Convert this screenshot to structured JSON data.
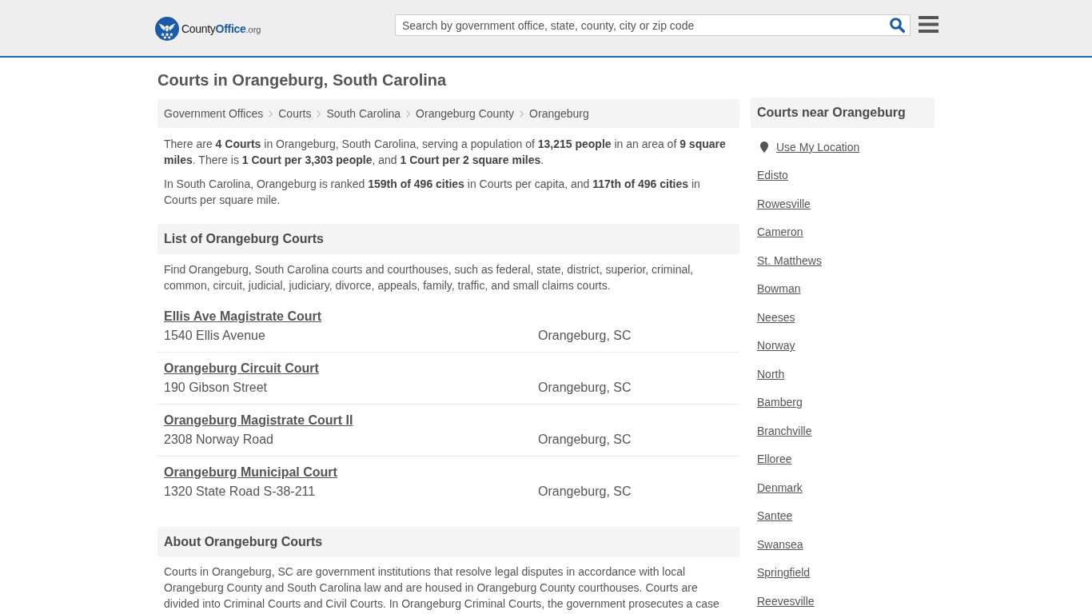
{
  "header": {
    "logo": {
      "name": "County",
      "highlight": "Office",
      "suffix": ".org"
    },
    "search": {
      "placeholder": "Search by government office, state, county, city or zip code"
    }
  },
  "page_title": "Courts in Orangeburg, South Carolina",
  "breadcrumb": [
    "Government Offices",
    "Courts",
    "South Carolina",
    "Orangeburg County",
    "Orangeburg"
  ],
  "intro": [
    "There are **4 Courts** in Orangeburg, South Carolina, serving a population of **13,215 people** in an area of **9 square miles**. There is **1 Court per 3,303 people**, and **1 Court per 2 square miles**.",
    "In South Carolina, Orangeburg is ranked **159th of 496 cities** in Courts per capita, and **117th of 496 cities** in Courts per square mile."
  ],
  "list_section": {
    "heading": "List of Orangeburg Courts",
    "description": "Find Orangeburg, South Carolina courts and courthouses, such as federal, state, district, superior, criminal, common, circuit, judicial, judiciary, divorce, appeals, family, traffic, and small claims courts.",
    "courts": [
      {
        "name": "Ellis Ave Magistrate Court",
        "address": "1540 Ellis Avenue",
        "city": "Orangeburg, SC"
      },
      {
        "name": "Orangeburg Circuit Court",
        "address": "190 Gibson Street",
        "city": "Orangeburg, SC"
      },
      {
        "name": "Orangeburg Magistrate Court II",
        "address": "2308 Norway Road",
        "city": "Orangeburg, SC"
      },
      {
        "name": "Orangeburg Municipal Court",
        "address": "1320 State Road S-38-211",
        "city": "Orangeburg, SC"
      }
    ]
  },
  "about_section": {
    "heading": "About Orangeburg Courts",
    "text": "Courts in Orangeburg, SC are government institutions that resolve legal disputes in accordance with local Orangeburg County and South Carolina law and are housed in Orangeburg County courthouses. Courts are divided into Criminal Courts and Civil Courts. In Orangeburg Criminal Courts, the government prosecutes a case"
  },
  "sidebar": {
    "heading": "Courts near Orangeburg",
    "location_link": "Use My Location",
    "links": [
      "Edisto",
      "Rowesville",
      "Cameron",
      "St. Matthews",
      "Bowman",
      "Neeses",
      "Norway",
      "North",
      "Bamberg",
      "Branchville",
      "Elloree",
      "Denmark",
      "Santee",
      "Swansea",
      "Springfield",
      "Reevesville"
    ]
  }
}
